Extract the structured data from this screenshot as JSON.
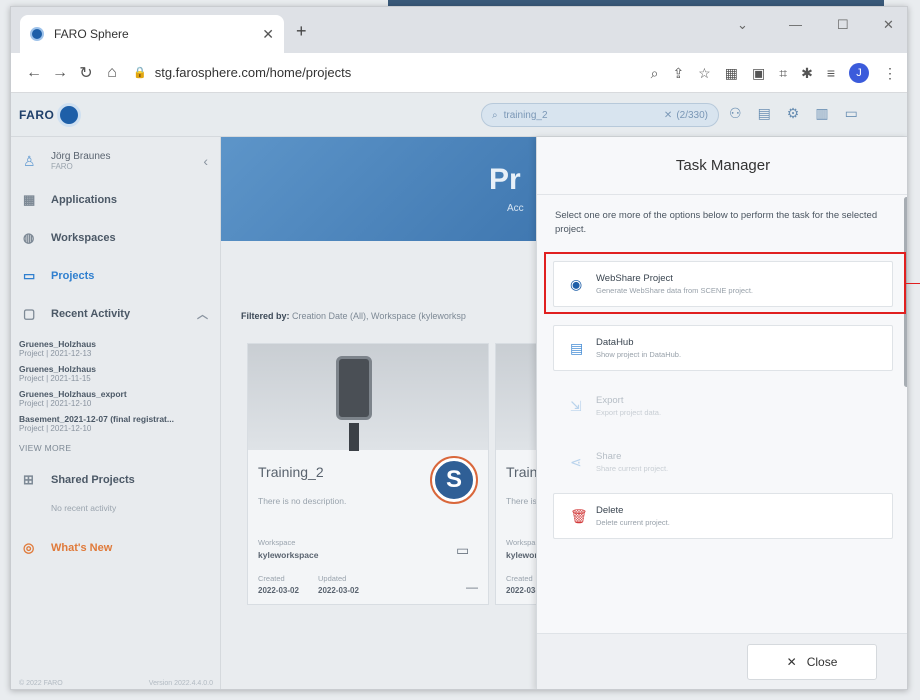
{
  "browser": {
    "tab_title": "FARO Sphere",
    "url": "stg.farosphere.com/home/projects",
    "profile_initial": "J"
  },
  "app": {
    "logo_text": "FARO",
    "search_query": "training_2",
    "search_count": "(2/330)"
  },
  "sidebar": {
    "user_name": "Jörg Braunes",
    "user_org": "FARO",
    "items": [
      {
        "label": "Applications"
      },
      {
        "label": "Workspaces"
      },
      {
        "label": "Projects"
      }
    ],
    "recent_label": "Recent Activity",
    "recent": [
      {
        "name": "Gruenes_Holzhaus",
        "meta": "Project | 2021-12-13"
      },
      {
        "name": "Gruenes_Holzhaus",
        "meta": "Project | 2021-11-15"
      },
      {
        "name": "Gruenes_Holzhaus_export",
        "meta": "Project | 2021-12-10"
      },
      {
        "name": "Basement_2021-12-07 (final registrat...",
        "meta": "Project | 2021-12-10"
      }
    ],
    "view_more": "VIEW MORE",
    "shared_label": "Shared Projects",
    "no_recent": "No recent activity",
    "whats_new": "What's New",
    "footer_left": "© 2022 FARO",
    "footer_right": "Version 2022.4.4.0.0"
  },
  "main": {
    "hero_title": "Pr",
    "hero_subtitle": "Acc",
    "filtered_label": "Filtered by:",
    "filtered_value": "Creation Date (All), Workspace (kyleworksp",
    "cards": [
      {
        "title": "Training_2",
        "description": "There is no description.",
        "workspace_label": "Workspace",
        "workspace": "kyleworkspace",
        "created_label": "Created",
        "created": "2022-03-02",
        "updated_label": "Updated",
        "updated": "2022-03-02",
        "badge": "S"
      },
      {
        "title": "Trainl",
        "description": "There is",
        "workspace_label": "Workspa",
        "workspace": "kylewor",
        "created_label": "Created",
        "created": "2022-03-"
      }
    ]
  },
  "task_manager": {
    "title": "Task Manager",
    "description": "Select one ore more of the options below to perform the task for the selected project.",
    "options": [
      {
        "name": "WebShare Project",
        "desc": "Generate WebShare data from SCENE project.",
        "icon": "webshare-icon"
      },
      {
        "name": "DataHub",
        "desc": "Show project in DataHub.",
        "icon": "datahub-icon"
      },
      {
        "name": "Export",
        "desc": "Export project data.",
        "icon": "export-icon"
      },
      {
        "name": "Share",
        "desc": "Share current project.",
        "icon": "share-icon"
      },
      {
        "name": "Delete",
        "desc": "Delete current project.",
        "icon": "trash-icon"
      }
    ],
    "close_label": "Close"
  },
  "colors": {
    "accent": "#2f7fcf",
    "highlight": "#e02020",
    "delete": "#d23a3a"
  }
}
